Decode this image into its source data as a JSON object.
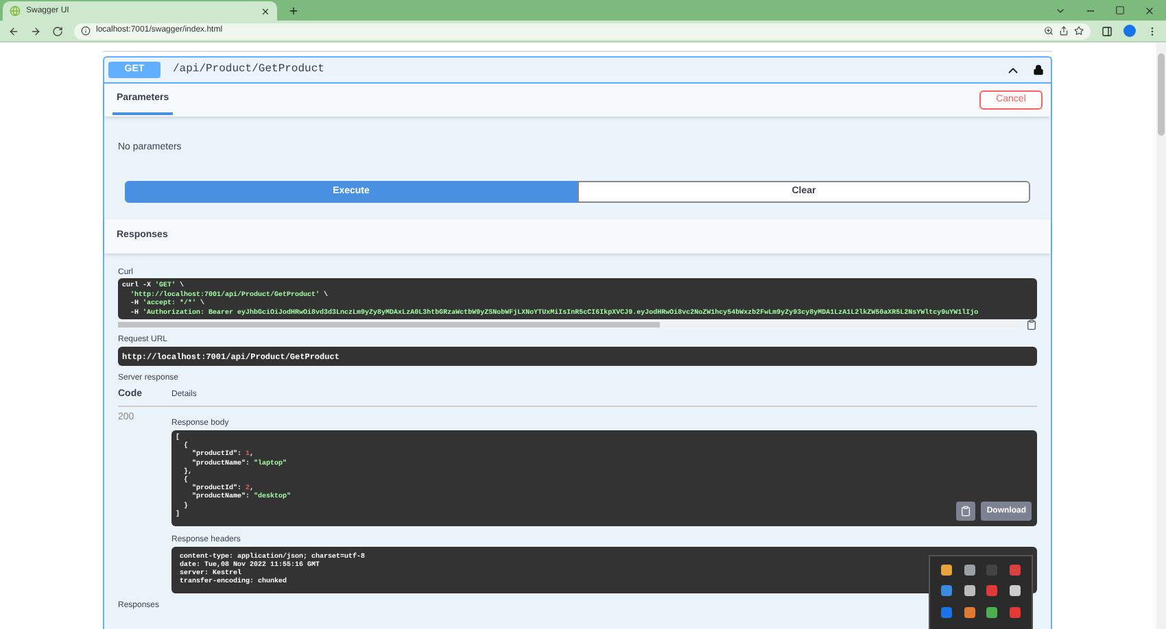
{
  "browser": {
    "tab_title": "Swagger UI",
    "url": "localhost:7001/swagger/index.html"
  },
  "operation": {
    "method": "GET",
    "path": "/api/Product/GetProduct",
    "tabs": [
      {
        "label": "Parameters",
        "selected": true
      }
    ],
    "cancel_button": "Cancel",
    "parameters_text": "No parameters",
    "buttons": [
      {
        "label": "Execute",
        "kind": "primary"
      },
      {
        "label": "Clear",
        "kind": "secondary"
      }
    ]
  },
  "responses": {
    "heading": "Responses",
    "curl": {
      "label": "Curl",
      "lines": [
        [
          {
            "text": "curl -X ",
            "kind": "plain"
          },
          {
            "text": "'GET'",
            "kind": "string"
          },
          {
            "text": " \\",
            "kind": "plain"
          }
        ],
        [
          {
            "text": "  'http://localhost:7001/api/Product/GetProduct'",
            "kind": "string"
          },
          {
            "text": " \\",
            "kind": "plain"
          }
        ],
        [
          {
            "text": "  -H ",
            "kind": "plain"
          },
          {
            "text": "'accept: */*'",
            "kind": "string"
          },
          {
            "text": " \\",
            "kind": "plain"
          }
        ],
        [
          {
            "text": "  -H ",
            "kind": "plain"
          },
          {
            "text": "'Authorization: Bearer eyJhbGciOiJodHRwOi8vd3d3LnczLm9yZy8yMDAxLzA0L3htbGRzaWctbW9yZSNobWFjLXNoYTUxMiIsInR5cCI6IkpXVCJ9.eyJodHRwOi8vc2NoZW1hcy54bWxzb2FwLm9yZy93cy8yMDA1LzA1L2lkZW50aXR5L2NsYWltcy9uYW1lIjo",
            "kind": "string"
          }
        ]
      ]
    },
    "request_url": {
      "label": "Request URL",
      "value": "http://localhost:7001/api/Product/GetProduct"
    },
    "server_response": "Server response",
    "columns": [
      "Code",
      "Details"
    ],
    "code": "200",
    "body": {
      "label": "Response body",
      "lines": [
        [
          {
            "text": "[",
            "kind": "plain"
          }
        ],
        [
          {
            "text": "  {",
            "kind": "plain"
          }
        ],
        [
          {
            "text": "    \"productId\": ",
            "kind": "plain"
          },
          {
            "text": "1",
            "kind": "number"
          },
          {
            "text": ",",
            "kind": "plain"
          }
        ],
        [
          {
            "text": "    \"productName\": ",
            "kind": "plain"
          },
          {
            "text": "\"laptop\"",
            "kind": "string"
          }
        ],
        [
          {
            "text": "  },",
            "kind": "plain"
          }
        ],
        [
          {
            "text": "  {",
            "kind": "plain"
          }
        ],
        [
          {
            "text": "    \"productId\": ",
            "kind": "plain"
          },
          {
            "text": "2",
            "kind": "number"
          },
          {
            "text": ",",
            "kind": "plain"
          }
        ],
        [
          {
            "text": "    \"productName\": ",
            "kind": "plain"
          },
          {
            "text": "\"desktop\"",
            "kind": "string"
          }
        ],
        [
          {
            "text": "  }",
            "kind": "plain"
          }
        ],
        [
          {
            "text": "]",
            "kind": "plain"
          }
        ]
      ],
      "download_button": "Download"
    },
    "headers": {
      "label": "Response headers",
      "lines": [
        "content-type: application/json; charset=utf-8",
        "date: Tue,08 Nov 2022 11:55:16 GMT",
        "server: Kestrel",
        "transfer-encoding: chunked"
      ]
    },
    "footer": "Responses"
  }
}
